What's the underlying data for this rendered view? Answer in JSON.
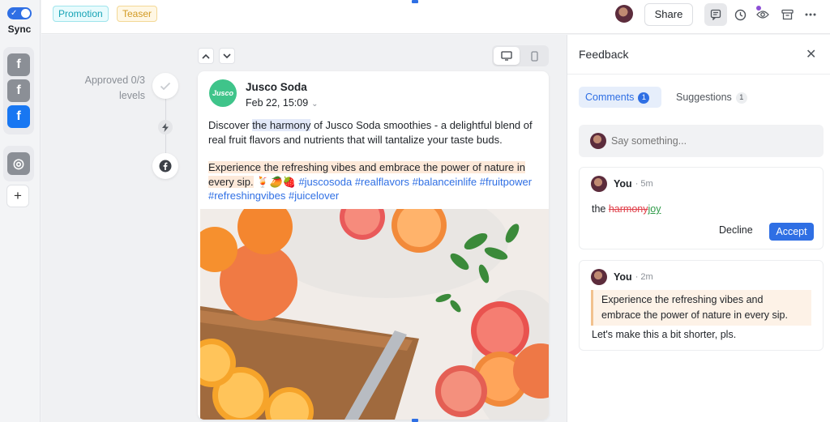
{
  "sync": {
    "label": "Sync",
    "enabled": true,
    "check": "✓"
  },
  "rail": {
    "networks": [
      "facebook-gray",
      "facebook-gray",
      "facebook-blue"
    ],
    "networks_glyph": "f",
    "instagram_glyph": "◎",
    "add_label": "+"
  },
  "topbar": {
    "tags": {
      "promotion": "Promotion",
      "teaser": "Teaser"
    },
    "share_label": "Share",
    "colors": {
      "promotion": "#16a3b5",
      "teaser": "#d29a24",
      "accent": "#2f6fe4"
    }
  },
  "approval": {
    "status": "Approved 0/3 levels"
  },
  "post": {
    "brand_logo_text": "Jusco",
    "brand_name": "Jusco Soda",
    "date": "Feb 22, 15:09",
    "text1_before": "Discover ",
    "text1_highlight": "the harmony",
    "text1_after": " of Jusco Soda smoothies - a delightful blend of real fruit flavors and nutrients that will tantalize your taste buds.",
    "text2_highlight": "Experience the refreshing vibes and embrace the power of nature in every sip.",
    "text2_emoji": " 🍹🥭🍓 ",
    "hashtags": "#juscosoda #realflavors #balanceinlife #fruitpower #refreshingvibes #juicelover"
  },
  "feedback": {
    "title": "Feedback",
    "tabs": {
      "comments": "Comments",
      "comments_count": "1",
      "suggestions": "Suggestions",
      "suggestions_count": "1"
    },
    "input_placeholder": "Say something...",
    "suggestion_card": {
      "author": "You",
      "time": "· 5m",
      "prefix": "the ",
      "deleted": "harmony",
      "inserted": "joy",
      "decline": "Decline",
      "accept": "Accept"
    },
    "comment_card": {
      "author": "You",
      "time": "· 2m",
      "quote": "Experience the refreshing vibes and embrace the power of nature in every sip.",
      "text": "Let's make this a bit shorter, pls."
    }
  }
}
